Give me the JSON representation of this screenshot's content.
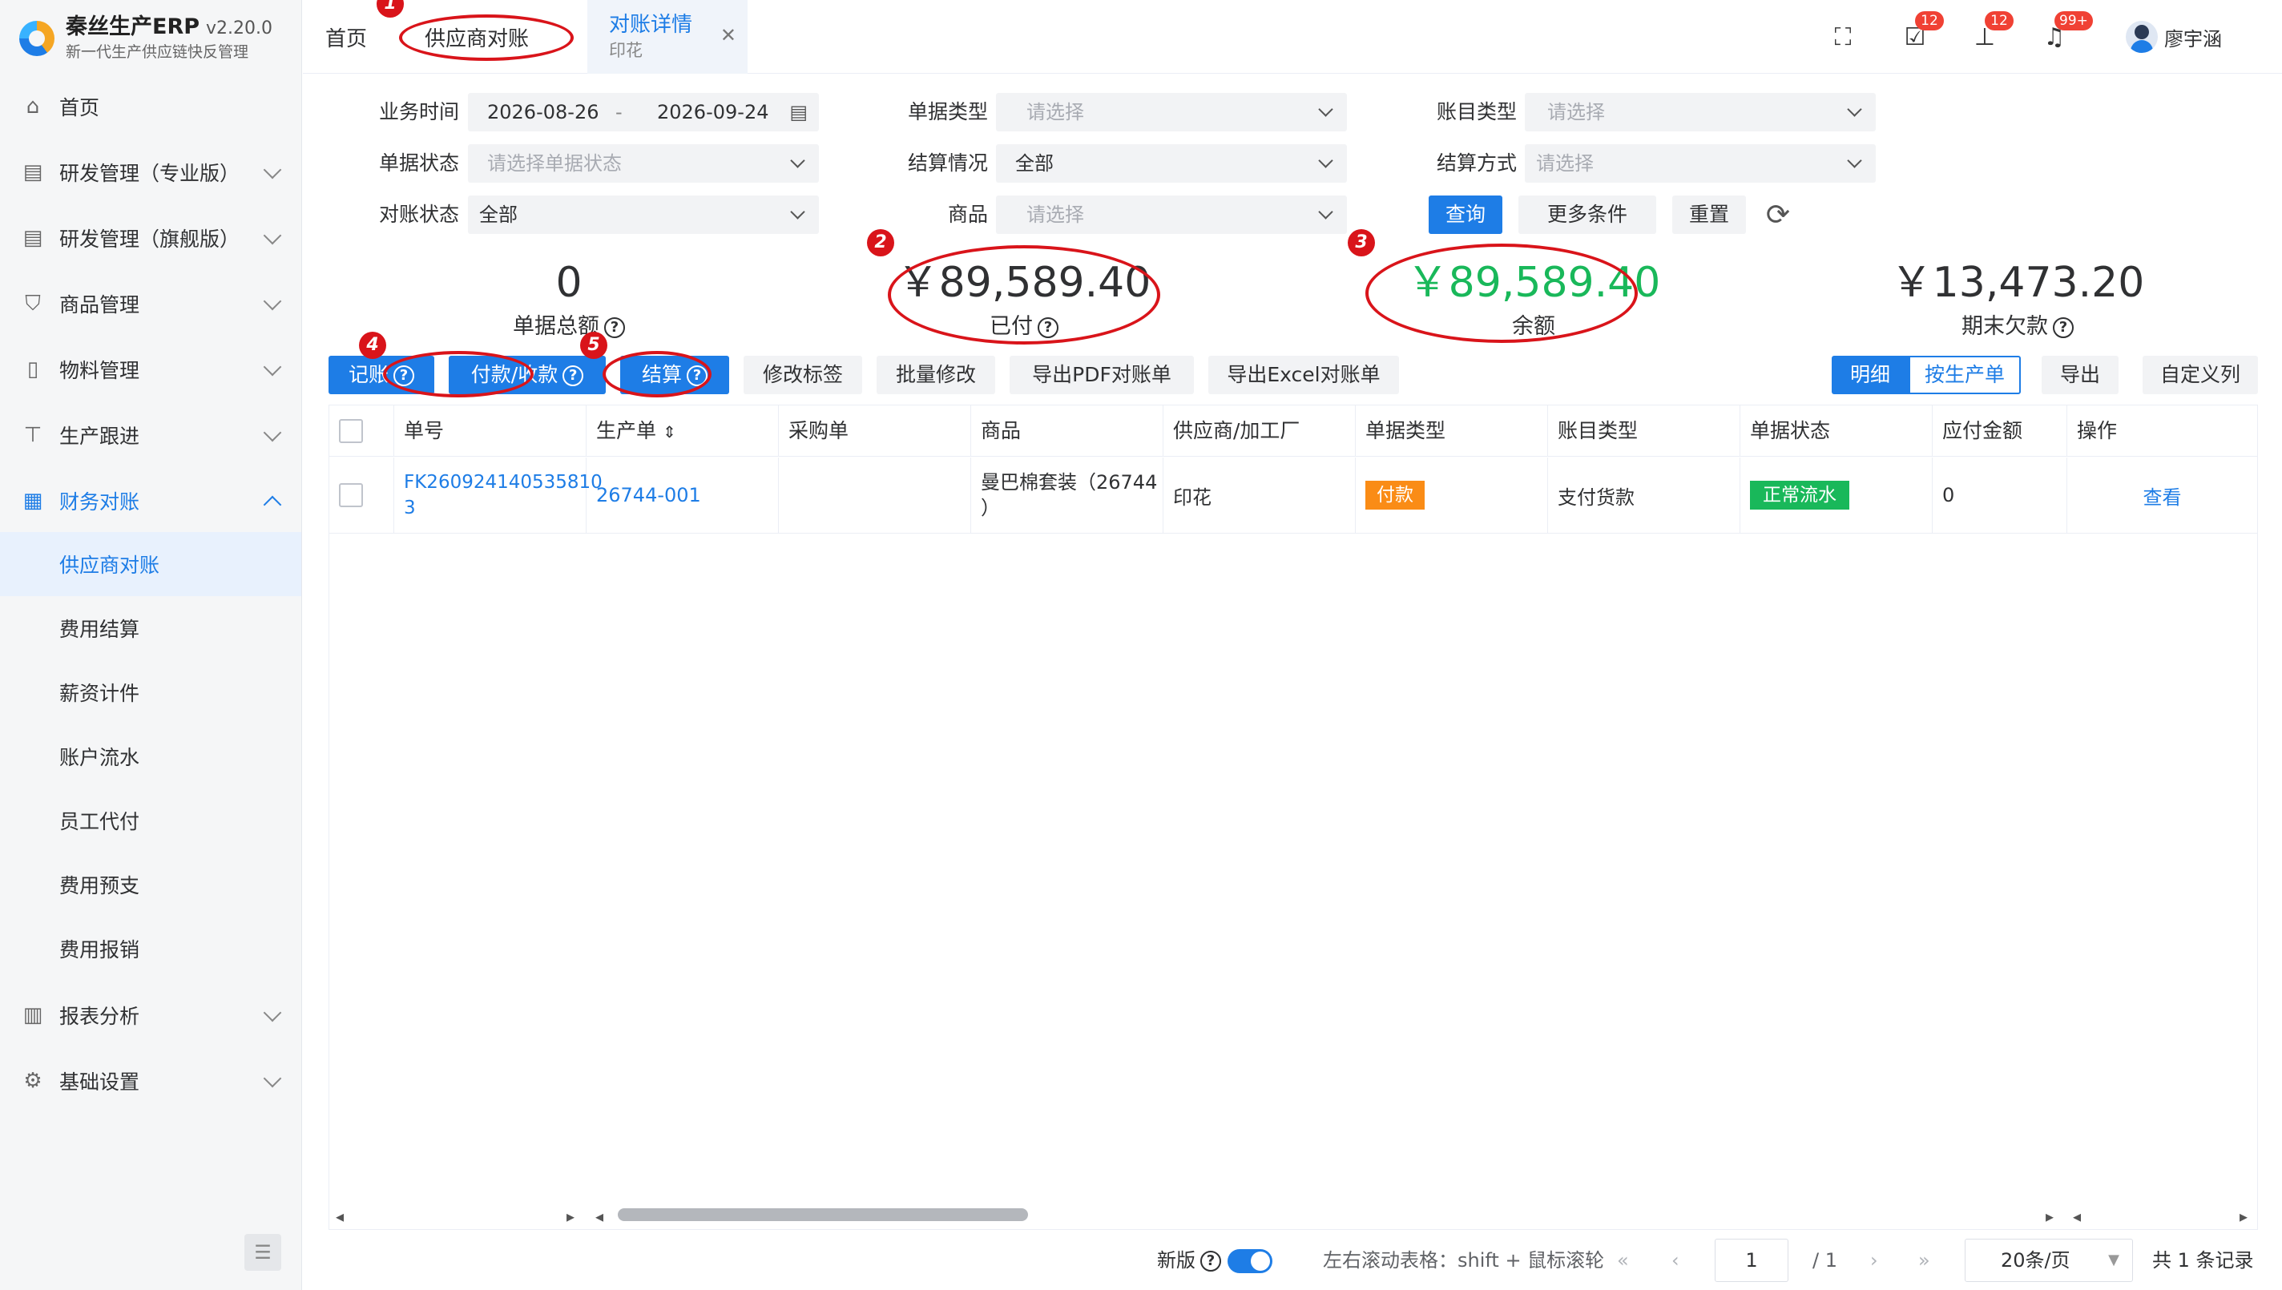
{
  "app": {
    "name": "秦丝生产ERP",
    "version": "v2.20.0",
    "slogan": "新一代生产供应链快反管理"
  },
  "sidebar": {
    "items": [
      {
        "label": "首页",
        "icon": "home-icon"
      },
      {
        "label": "研发管理（专业版）",
        "icon": "book-icon"
      },
      {
        "label": "研发管理（旗舰版）",
        "icon": "book-icon"
      },
      {
        "label": "商品管理",
        "icon": "shirt-icon"
      },
      {
        "label": "物料管理",
        "icon": "document-icon"
      },
      {
        "label": "生产跟进",
        "icon": "stamp-icon"
      },
      {
        "label": "财务对账",
        "icon": "grid-icon",
        "expanded": true
      },
      {
        "label": "报表分析",
        "icon": "bar-chart-icon"
      },
      {
        "label": "基础设置",
        "icon": "gear-icon"
      }
    ],
    "finance_sub": [
      "供应商对账",
      "费用结算",
      "薪资计件",
      "账户流水",
      "员工代付",
      "费用预支",
      "费用报销"
    ],
    "selected_sub": "供应商对账"
  },
  "tabs": {
    "home": "首页",
    "supplier": "供应商对账",
    "detail": "对账详情",
    "detail_sub": "印花"
  },
  "header": {
    "badges": [
      "12",
      "12",
      "99+"
    ],
    "user": "廖宇涵"
  },
  "filters": {
    "biz_time_label": "业务时间",
    "date_start": "2026-08-26",
    "date_sep": "-",
    "date_end": "2026-09-24",
    "doc_type_label": "单据类型",
    "doc_type_ph": "请选择",
    "acct_type_label": "账目类型",
    "acct_type_ph": "请选择",
    "doc_status_label": "单据状态",
    "doc_status_ph": "请选择单据状态",
    "settle_label": "结算情况",
    "settle_value": "全部",
    "settle_method_label": "结算方式",
    "settle_method_ph": "请选择",
    "recon_label": "对账状态",
    "recon_value": "全部",
    "goods_label": "商品",
    "goods_ph": "请选择",
    "query": "查询",
    "more": "更多条件",
    "reset": "重置"
  },
  "stats": [
    {
      "value": "0",
      "label": "单据总额"
    },
    {
      "value": "￥89,589.40",
      "label": "已付"
    },
    {
      "value": "￥89,589.40",
      "label": "余额"
    },
    {
      "value": "￥13,473.20",
      "label": "期末欠款"
    }
  ],
  "toolbar": {
    "record": "记账",
    "pay": "付款/收款",
    "settle": "结算",
    "edit_tag": "修改标签",
    "batch_edit": "批量修改",
    "export_pdf": "导出PDF对账单",
    "export_excel": "导出Excel对账单",
    "view_detail": "明细",
    "view_by_order": "按生产单",
    "export": "导出",
    "custom_cols": "自定义列"
  },
  "annotations": [
    "1",
    "2",
    "3",
    "4",
    "5"
  ],
  "table": {
    "headers": [
      "单号",
      "生产单",
      "采购单",
      "商品",
      "供应商/加工厂",
      "单据类型",
      "账目类型",
      "单据状态",
      "应付金额",
      "操作"
    ],
    "rows": [
      {
        "no_l1": "FK260924140535810",
        "no_l2": "3",
        "order": "26744-001",
        "purchase": "",
        "goods_l1": "曼巴棉套装（26744",
        "goods_l2": "）",
        "supplier": "印花",
        "doc_type": "付款",
        "acct_type": "支付货款",
        "status": "正常流水",
        "amount": "0",
        "action": "查看"
      }
    ],
    "colors": {
      "doc_type": "#fa8c16",
      "status": "#19b85a"
    }
  },
  "footer": {
    "new_ver": "新版",
    "scroll_hint": "左右滚动表格：shift + 鼠标滚轮",
    "page": "1",
    "total_pages": "/ 1",
    "page_size": "20条/页",
    "total": "共 1 条记录"
  }
}
